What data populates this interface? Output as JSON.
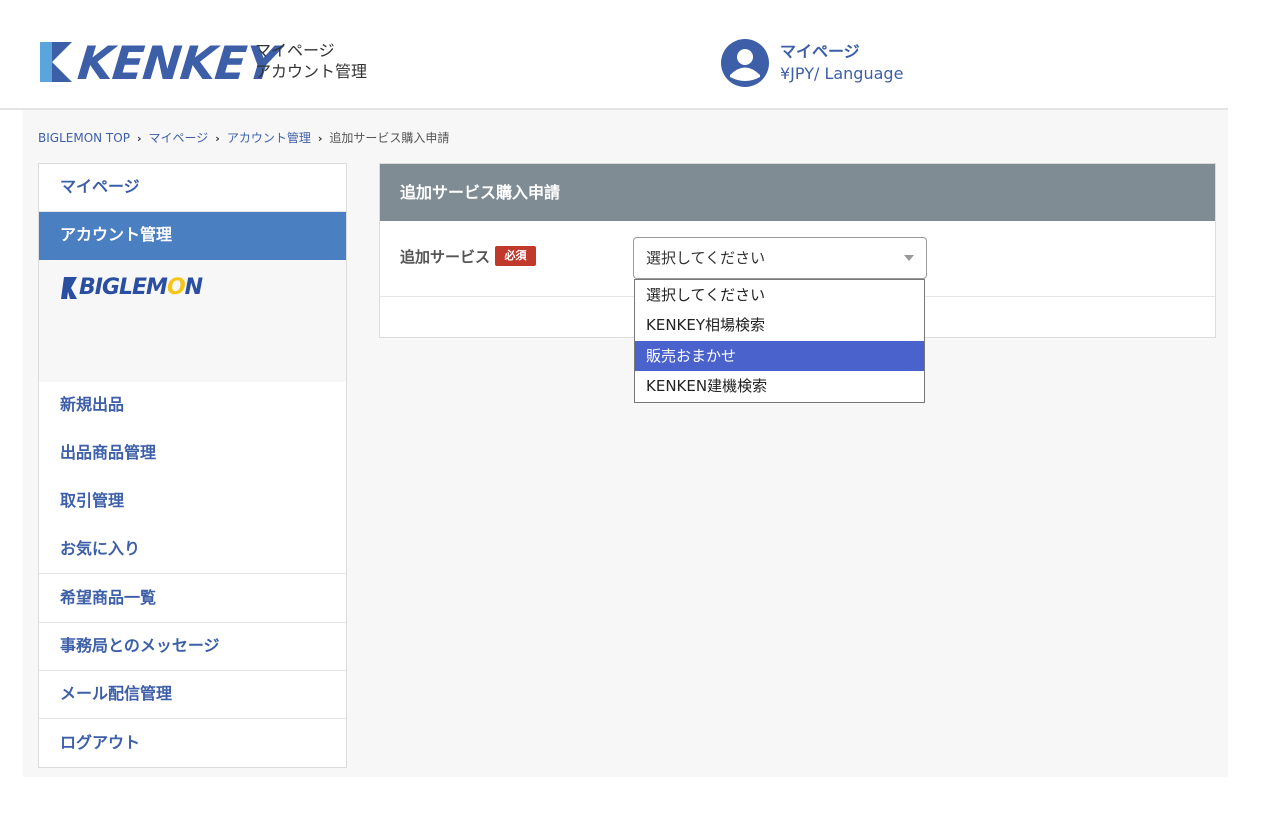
{
  "header": {
    "brand": "KENKEY",
    "sub_line1": "マイページ",
    "sub_line2": "アカウント管理",
    "user_label": "マイページ",
    "lang_label": "¥JPY/ Language",
    "accent": "#3d5fa8"
  },
  "breadcrumb": {
    "items": [
      "BIGLEMON TOP",
      "マイページ",
      "アカウント管理"
    ],
    "current": "追加サービス購入申請"
  },
  "sidebar": {
    "items": [
      {
        "label": "マイページ"
      },
      {
        "label": "アカウント管理",
        "active": true
      }
    ],
    "brand": "BIGLEMON",
    "menu": [
      {
        "label": "新規出品"
      },
      {
        "label": "出品商品管理"
      },
      {
        "label": "取引管理"
      },
      {
        "label": "お気に入り"
      },
      {
        "label": "希望商品一覧"
      },
      {
        "label": "事務局とのメッセージ"
      },
      {
        "label": "メール配信管理"
      },
      {
        "label": "ログアウト"
      }
    ]
  },
  "panel": {
    "title": "追加サービス購入申請",
    "field_label": "追加サービス",
    "required_badge": "必須",
    "select_value": "選択してください",
    "options": [
      "選択してください",
      "KENKEY相場検索",
      "販売おまかせ",
      "KENKEN建機検索"
    ],
    "highlighted_option": "販売おまかせ",
    "header_color": "#7f8c93",
    "highlight_color": "#4a62cc"
  }
}
